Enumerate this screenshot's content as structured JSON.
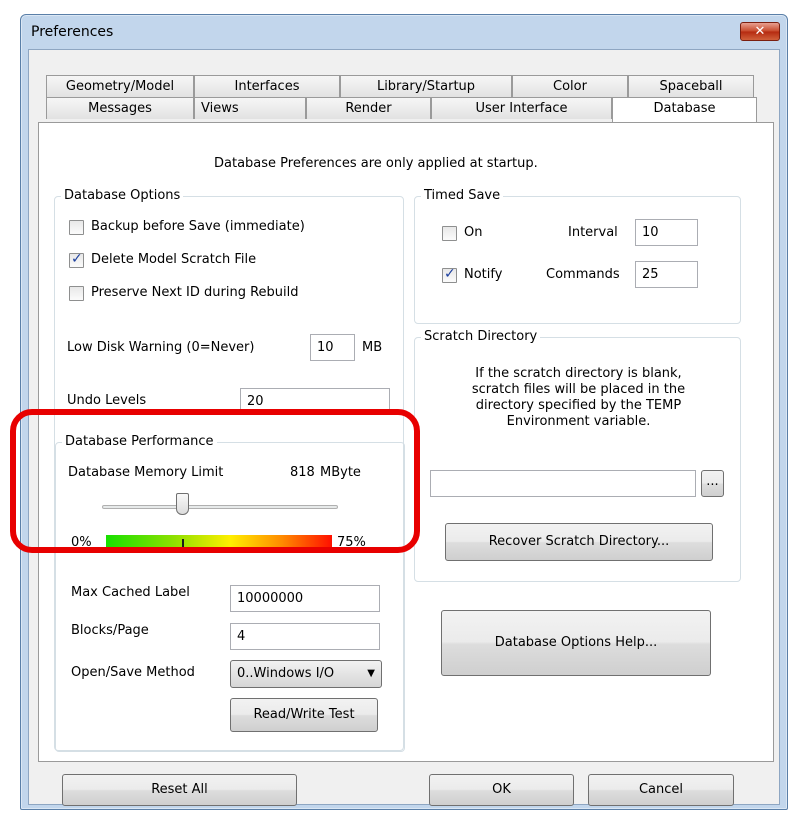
{
  "window": {
    "title": "Preferences",
    "close_glyph": "✕"
  },
  "tabs_row1": [
    "Geometry/Model",
    "Interfaces",
    "Library/Startup",
    "Color",
    "Spaceball"
  ],
  "tabs_row2": [
    "Messages",
    "Views",
    "Render",
    "User Interface",
    "Database"
  ],
  "active_tab": "Database",
  "notice": "Database Preferences are only applied at startup.",
  "database_options": {
    "title": "Database Options",
    "backup_before_save": {
      "label": "Backup before Save (immediate)",
      "checked": false
    },
    "delete_scratch": {
      "label": "Delete Model Scratch File",
      "checked": true
    },
    "preserve_next_id": {
      "label": "Preserve Next ID during Rebuild",
      "checked": false
    },
    "low_disk_label": "Low Disk Warning (0=Never)",
    "low_disk_value": "10",
    "low_disk_unit": "MB",
    "undo_label": "Undo Levels",
    "undo_value": "20"
  },
  "performance": {
    "title": "Database Performance",
    "memory_label": "Database Memory Limit",
    "memory_value": "818",
    "memory_unit": "MByte",
    "slider_fraction": 0.34,
    "min_label": "0%",
    "max_label": "75%",
    "max_cached_label": "Max Cached Label",
    "max_cached_value": "10000000",
    "blocks_label": "Blocks/Page",
    "blocks_value": "4",
    "open_save_label": "Open/Save Method",
    "open_save_value": "0..Windows I/O",
    "rw_test_label": "Read/Write Test"
  },
  "timed_save": {
    "title": "Timed Save",
    "on": {
      "label": "On",
      "checked": false
    },
    "interval_label": "Interval",
    "interval_value": "10",
    "notify": {
      "label": "Notify",
      "checked": true
    },
    "commands_label": "Commands",
    "commands_value": "25"
  },
  "scratch": {
    "title": "Scratch Directory",
    "info_line1": "If the scratch directory is blank,",
    "info_line2": "scratch files will be placed in the",
    "info_line3": "directory specified by the TEMP",
    "info_line4": "Environment variable.",
    "path_value": "",
    "browse_label": "...",
    "recover_label": "Recover Scratch Directory..."
  },
  "help_label": "Database Options Help...",
  "footer": {
    "reset_label": "Reset All",
    "ok_label": "OK",
    "cancel_label": "Cancel"
  },
  "colors": {
    "annotation_red": "#e80000",
    "title_blue": "#c2d6ec",
    "close_red": "#c74a2c"
  }
}
